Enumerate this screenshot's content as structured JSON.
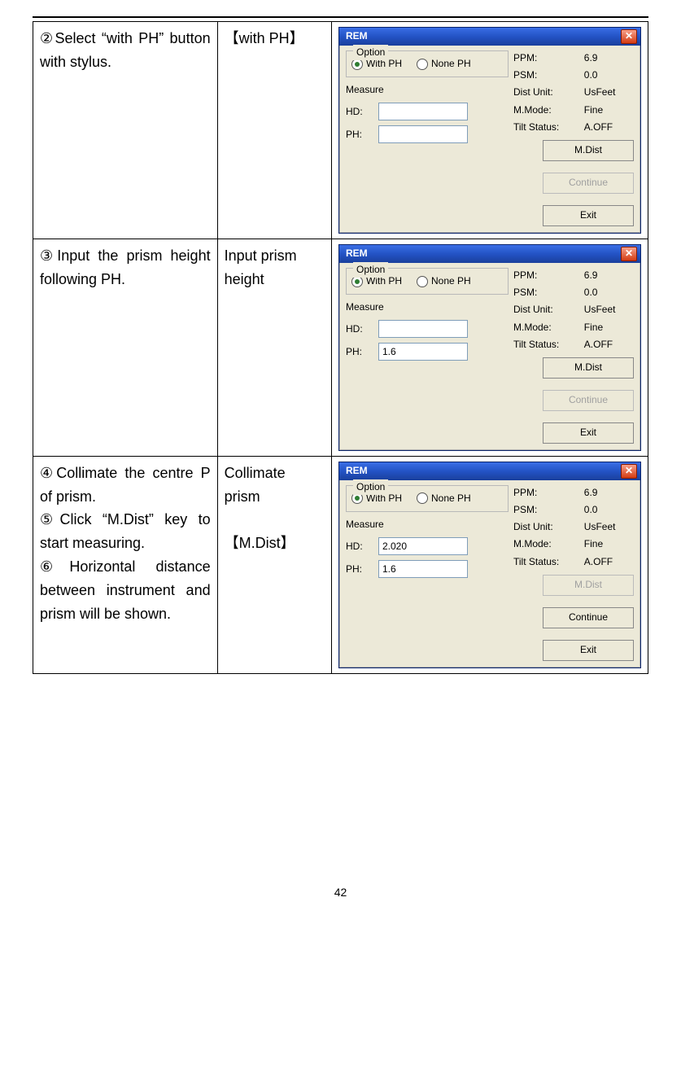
{
  "page_number": "42",
  "rows": [
    {
      "desc": "②Select “with PH” button with stylus.",
      "action": "【with PH】",
      "win": {
        "title": "REM",
        "option_label": "Option",
        "with_ph": "With PH",
        "none_ph": "None PH",
        "measure_label": "Measure",
        "hd_label": "HD:",
        "hd_value": "",
        "ph_label": "PH:",
        "ph_value": "",
        "info": {
          "ppm_label": "PPM:",
          "ppm": "6.9",
          "psm_label": "PSM:",
          "psm": "0.0",
          "dist_label": "Dist Unit:",
          "dist": "UsFeet",
          "mmode_label": "M.Mode:",
          "mmode": "Fine",
          "tilt_label": "Tilt Status:",
          "tilt": "A.OFF"
        },
        "btn_mdist": "M.Dist",
        "btn_continue": "Continue",
        "btn_exit": "Exit",
        "continue_disabled": true,
        "mdist_disabled": false
      }
    },
    {
      "desc": "③Input the prism height following PH.",
      "action": "Input prism height",
      "win": {
        "title": "REM",
        "option_label": "Option",
        "with_ph": "With PH",
        "none_ph": "None PH",
        "measure_label": "Measure",
        "hd_label": "HD:",
        "hd_value": "",
        "ph_label": "PH:",
        "ph_value": "1.6",
        "info": {
          "ppm_label": "PPM:",
          "ppm": "6.9",
          "psm_label": "PSM:",
          "psm": "0.0",
          "dist_label": "Dist Unit:",
          "dist": "UsFeet",
          "mmode_label": "M.Mode:",
          "mmode": "Fine",
          "tilt_label": "Tilt Status:",
          "tilt": "A.OFF"
        },
        "btn_mdist": "M.Dist",
        "btn_continue": "Continue",
        "btn_exit": "Exit",
        "continue_disabled": true,
        "mdist_disabled": false
      }
    },
    {
      "desc": "④Collimate the centre P of prism.\n⑤Click “M.Dist” key to start measuring.\n⑥Horizontal distance between instrument and prism will be shown.",
      "action": "Collimate prism\n\n【M.Dist】",
      "win": {
        "title": "REM",
        "option_label": "Option",
        "with_ph": "With PH",
        "none_ph": "None PH",
        "measure_label": "Measure",
        "hd_label": "HD:",
        "hd_value": "2.020",
        "ph_label": "PH:",
        "ph_value": "1.6",
        "info": {
          "ppm_label": "PPM:",
          "ppm": "6.9",
          "psm_label": "PSM:",
          "psm": "0.0",
          "dist_label": "Dist Unit:",
          "dist": "UsFeet",
          "mmode_label": "M.Mode:",
          "mmode": "Fine",
          "tilt_label": "Tilt Status:",
          "tilt": "A.OFF"
        },
        "btn_mdist": "M.Dist",
        "btn_continue": "Continue",
        "btn_exit": "Exit",
        "continue_disabled": false,
        "mdist_disabled": true
      }
    }
  ]
}
